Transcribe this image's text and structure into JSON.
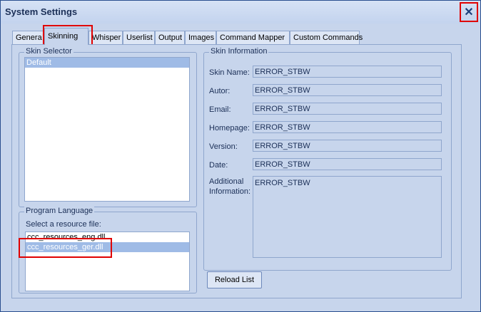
{
  "window": {
    "title": "System Settings"
  },
  "tabs": [
    "Genera",
    "Skinning",
    "Whisper",
    "Userlist",
    "Output",
    "Images",
    "Command Mapper",
    "Custom Commands"
  ],
  "skin_selector": {
    "legend": "Skin Selector",
    "items": [
      "Default"
    ]
  },
  "program_language": {
    "legend": "Program Language",
    "prompt": "Select a resource file:",
    "items": [
      "ccc_resources_eng.dll",
      "ccc_resources_ger.dll"
    ]
  },
  "skin_info": {
    "legend": "Skin Information",
    "fields": [
      {
        "label": "Skin Name:",
        "value": "ERROR_STBW"
      },
      {
        "label": "Autor:",
        "value": "ERROR_STBW"
      },
      {
        "label": "Email:",
        "value": "ERROR_STBW"
      },
      {
        "label": "Homepage:",
        "value": "ERROR_STBW"
      },
      {
        "label": "Version:",
        "value": "ERROR_STBW"
      },
      {
        "label": "Date:",
        "value": "ERROR_STBW"
      }
    ],
    "additional_label_1": "Additional",
    "additional_label_2": "Information:",
    "additional_value": "ERROR_STBW"
  },
  "buttons": {
    "reload": "Reload List"
  },
  "icons": {
    "close": "close-icon"
  }
}
